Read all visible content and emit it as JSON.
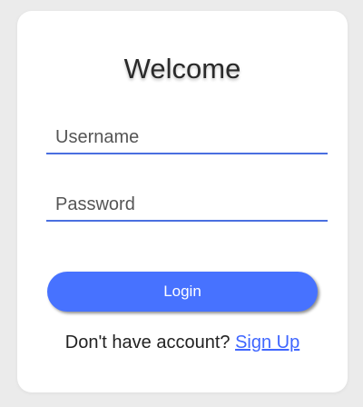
{
  "form": {
    "title": "Welcome",
    "username_placeholder": "Username",
    "password_placeholder": "Password",
    "login_label": "Login",
    "signup_prompt": "Don't have account?",
    "signup_link": "Sign Up"
  },
  "colors": {
    "accent": "#4772ff",
    "underline": "#4a6fe0",
    "link": "#3f66ff",
    "background": "#ebebeb",
    "card": "#ffffff"
  }
}
